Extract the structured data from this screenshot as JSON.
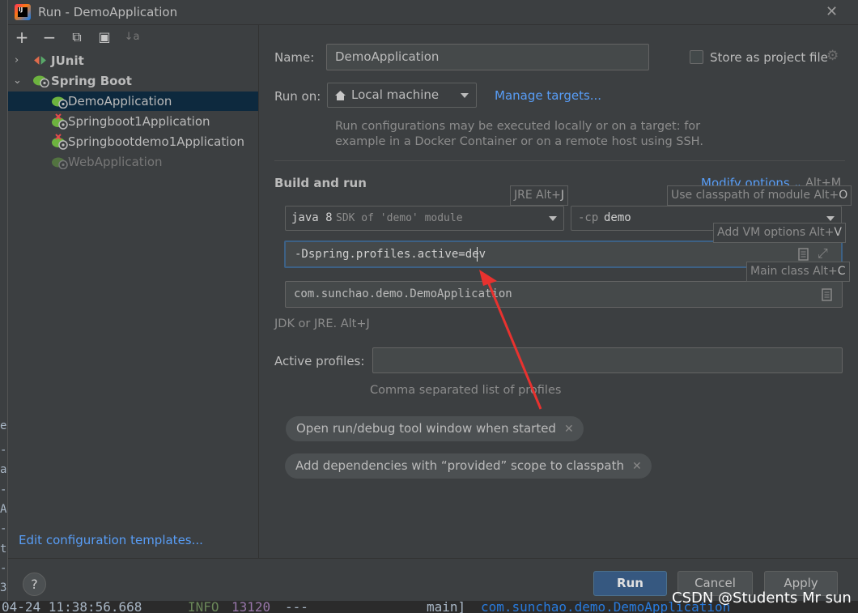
{
  "window": {
    "title": "Run - DemoApplication"
  },
  "toolbar": {
    "add": "+",
    "remove": "−",
    "copy": "⧉",
    "folder": "▣",
    "sort": "↓a"
  },
  "tree": {
    "junit": "JUnit",
    "spring_boot": "Spring Boot",
    "items": [
      "DemoApplication",
      "Springboot1Application",
      "Springbootdemo1Application",
      "WebApplication"
    ]
  },
  "left_footer": {
    "edit_templates": "Edit configuration templates..."
  },
  "form": {
    "name_label": "Name:",
    "name_value": "DemoApplication",
    "store_label": "Store as project file",
    "run_on_label": "Run on:",
    "run_on_value": "Local machine",
    "manage_targets": "Manage targets...",
    "run_on_hint_1": "Run configurations may be executed locally or on a target: for",
    "run_on_hint_2": "example in a Docker Container or on a remote host using SSH.",
    "build_and_run": "Build and run",
    "modify_options": "Modify options",
    "modify_shortcut": "Alt+M",
    "jre_prefix": "java 8",
    "jre_value": "SDK of 'demo' module",
    "cp_prefix": "-cp",
    "cp_value": "demo",
    "vm_options": "-Dspring.profiles.active=dev",
    "main_class": "com.sunchao.demo.DemoApplication",
    "jdk_hint": "JDK or JRE. Alt+J",
    "active_profiles_label": "Active profiles:",
    "active_profiles_value": "",
    "active_profiles_hint": "Comma separated list of profiles",
    "chip_1": "Open run/debug tool window when started",
    "chip_2": "Add dependencies with “provided” scope to classpath"
  },
  "tooltips": {
    "jre": "JRE Alt+",
    "jre_key": "J",
    "classpath": "Use classpath of module Alt+",
    "classpath_key": "O",
    "vm": "Add VM options Alt+",
    "vm_key": "V",
    "main": "Main class Alt+",
    "main_key": "C"
  },
  "buttons": {
    "help": "?",
    "run": "Run",
    "cancel": "Cancel",
    "apply": "Apply"
  },
  "background": {
    "log_time": "04-24 11:38:56.668",
    "log_level": "INFO",
    "log_pid": "13120",
    "log_sep": "---",
    "log_thread": "main]",
    "log_class": "com.sunchao.demo.DemoApplication"
  },
  "watermark": "CSDN @Students Mr sun",
  "colors": {
    "accent": "#589df6",
    "selection": "#0d293e",
    "arrow": "#e8322f",
    "primary_button": "#365880"
  }
}
